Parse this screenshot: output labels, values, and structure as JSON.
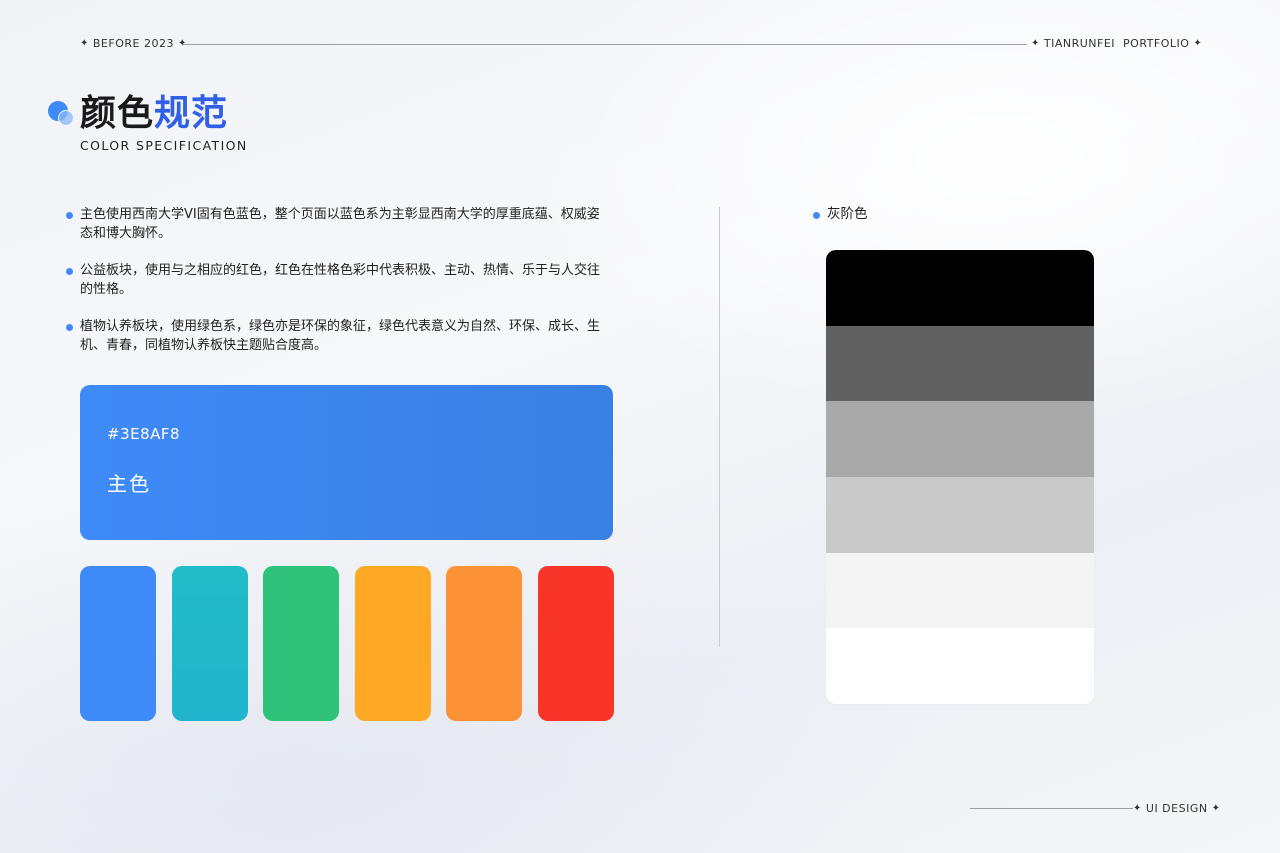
{
  "header": {
    "left_label": "BEFORE 2023",
    "right_label": "TIANRUNFEI  PORTFOLIO"
  },
  "title": {
    "part1": "颜色",
    "part2": "规范",
    "subtitle": "COLOR SPECIFICATION"
  },
  "bullets": [
    {
      "text": "主色使用西南大学VI固有色蓝色，整个页面以蓝色系为主彰显西南大学的厚重底蕴、权威姿态和博大胸怀。"
    },
    {
      "text": "公益板块，使用与之相应的红色，红色在性格色彩中代表积极、主动、热情、乐于与人交往的性格。"
    },
    {
      "text": "植物认养板块，使用绿色系，绿色亦是环保的象征，绿色代表意义为自然、环保、成长、生机、青春，同植物认养板快主题贴合度高。"
    }
  ],
  "main_color": {
    "hex": "#3E8AF8",
    "name": "主色"
  },
  "swatches": [
    {
      "color": "#3e8af8"
    },
    {
      "color": "#22bcc8"
    },
    {
      "color": "#2ec27a"
    },
    {
      "color": "#fea826"
    },
    {
      "color": "#fd9136"
    },
    {
      "color": "#f9352a"
    }
  ],
  "grayscale": {
    "label": "灰阶色",
    "steps": [
      "#000000",
      "#616161",
      "#a9a9a9",
      "#cacaca",
      "#f4f4f4",
      "#ffffff"
    ]
  },
  "footer": {
    "label": "UI DESIGN"
  }
}
